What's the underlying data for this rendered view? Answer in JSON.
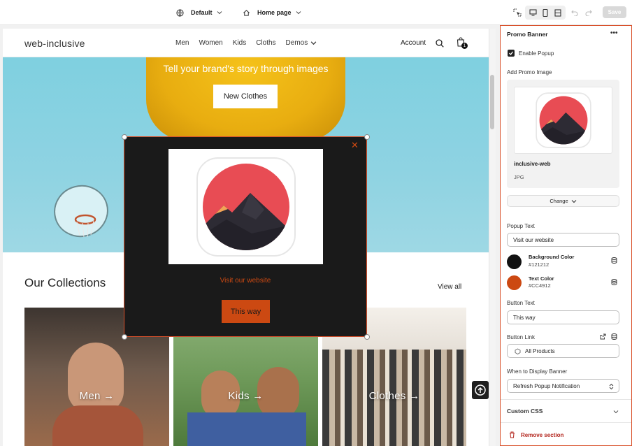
{
  "topbar": {
    "theme_label": "Default",
    "page_label": "Home page",
    "save_label": "Save"
  },
  "store": {
    "logo": "web-inclusive",
    "nav": [
      "Men",
      "Women",
      "Kids",
      "Cloths",
      "Demos"
    ],
    "account": "Account",
    "cart_count": "1",
    "hero_title": "Tell your brand's story through images",
    "hero_button": "New Clothes",
    "collections_title": "Our Collections",
    "view_all": "View all",
    "tiles": [
      "Men →",
      "Kids →",
      "Clothes →"
    ]
  },
  "popup": {
    "text": "Visit our website",
    "button": "This way",
    "close": "✕",
    "background_color": "#121212",
    "text_color": "#CC4912"
  },
  "panel": {
    "title": "Promo Banner",
    "enable_popup": "Enable Popup",
    "add_promo_image": "Add Promo Image",
    "image_name": "inclusive-web",
    "image_type": "JPG",
    "change_label": "Change",
    "popup_text_label": "Popup Text",
    "popup_text_value": "Visit our website",
    "bg_color_label": "Background Color",
    "bg_color_value": "#121212",
    "text_color_label": "Text Color",
    "text_color_value": "#CC4912",
    "button_text_label": "Button Text",
    "button_text_value": "This way",
    "button_link_label": "Button Link",
    "button_link_value": "All Products",
    "display_label": "When to Display Banner",
    "display_value": "Refresh Popup Notification",
    "custom_css": "Custom CSS",
    "remove_section": "Remove section"
  }
}
